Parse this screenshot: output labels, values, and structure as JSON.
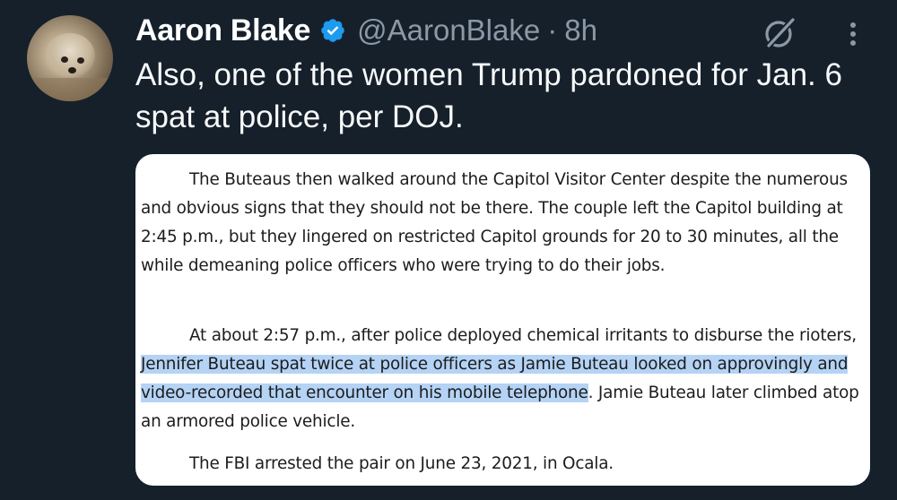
{
  "tweet": {
    "author": {
      "display_name": "Aaron Blake",
      "handle": "@AaronBlake",
      "verified": true,
      "avatar_icon": "dog-avatar"
    },
    "separator": "·",
    "time_ago": "8h",
    "text": "Also, one of the women Trump pardoned for Jan. 6 spat at police, per DOJ.",
    "actions": {
      "grok_icon": "grok-icon",
      "more_icon": "more-vertical-icon"
    },
    "colors": {
      "background": "#15202b",
      "verified_blue": "#1d9bf0",
      "secondary_text": "#8b98a5",
      "highlight": "#b4d3f5"
    }
  },
  "document_image": {
    "paragraph1": "The Buteaus then walked around the Capitol Visitor Center despite the numerous and obvious signs that they should not be there. The couple left the Capitol building at 2:45 p.m., but they lingered on restricted Capitol grounds for 20 to 30 minutes, all the while demeaning police officers who were trying to do their jobs.",
    "paragraph2_before": "At about 2:57 p.m., after police deployed chemical irritants to disburse the rioters,",
    "paragraph2_highlighted": "Jennifer Buteau spat twice at police officers as Jamie Buteau looked on approvingly and video-recorded that encounter on his mobile telephone",
    "paragraph2_after": ". Jamie Buteau later climbed atop an armored police vehicle.",
    "paragraph3": "The FBI arrested the pair on June 23, 2021, in Ocala."
  }
}
